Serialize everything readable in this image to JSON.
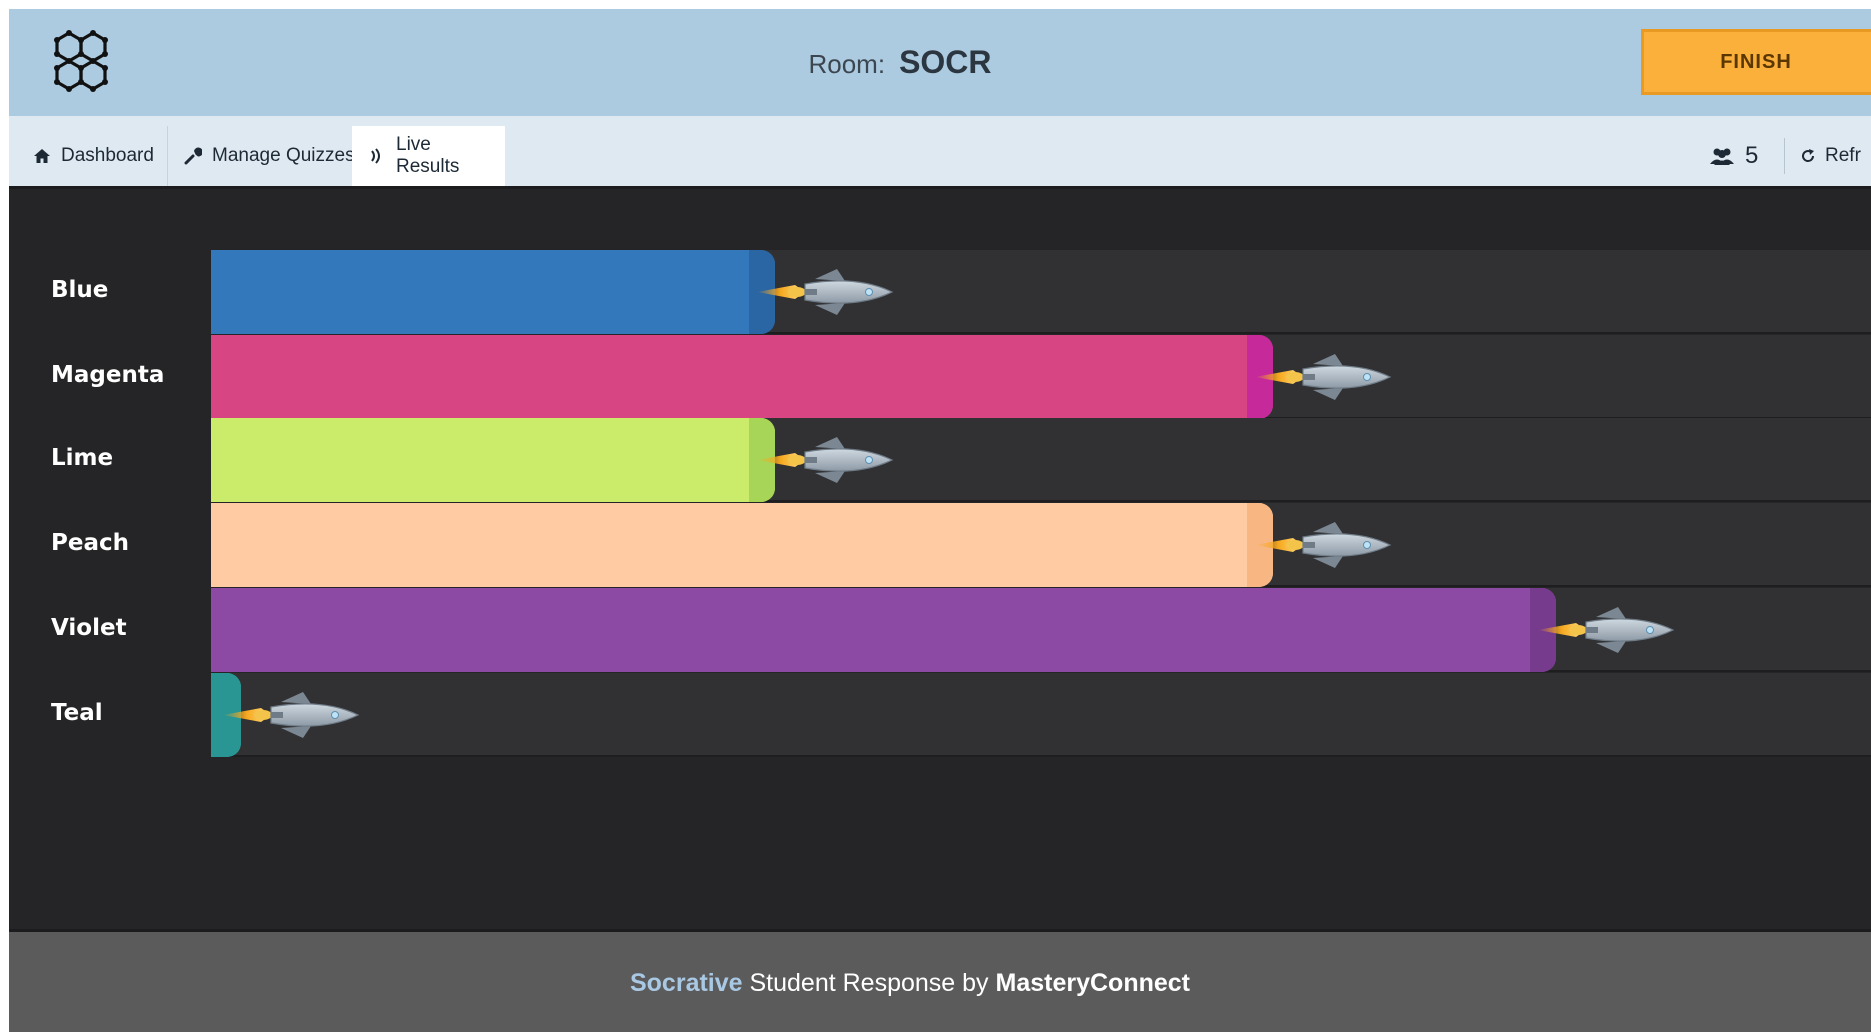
{
  "header": {
    "logo_icon": "hexagon-molecule-icon",
    "room_label": "Room:",
    "room_name": "SOCR",
    "finish_label": "FINISH"
  },
  "nav": {
    "tabs": [
      {
        "label": "Dashboard",
        "icon": "home-icon"
      },
      {
        "label": "Manage Quizzes",
        "icon": "wrench-icon"
      },
      {
        "label": "Live Results",
        "icon": "broadcast-icon",
        "active": true
      }
    ],
    "student_count": "5",
    "student_icon": "users-icon",
    "refresh_label": "Refr",
    "refresh_icon": "refresh-icon"
  },
  "results": {
    "rows": [
      {
        "label": "Blue",
        "progress": 0.34,
        "color": "#3378bb",
        "cap": "#2a66a3"
      },
      {
        "label": "Magenta",
        "progress": 0.64,
        "color": "#d84583",
        "cap": "#c5299a"
      },
      {
        "label": "Lime",
        "progress": 0.34,
        "color": "#cbeb6b",
        "cap": "#a7d557"
      },
      {
        "label": "Peach",
        "progress": 0.64,
        "color": "#fecba2",
        "cap": "#f8b683"
      },
      {
        "label": "Violet",
        "progress": 0.81,
        "color": "#8d4aa4",
        "cap": "#773b8e"
      },
      {
        "label": "Teal",
        "progress": 0.0,
        "color": "#2a9693",
        "cap": "#2a9693"
      }
    ]
  },
  "footer": {
    "brand": "Socrative",
    "middle": " Student Response by ",
    "company": "MasteryConnect"
  }
}
